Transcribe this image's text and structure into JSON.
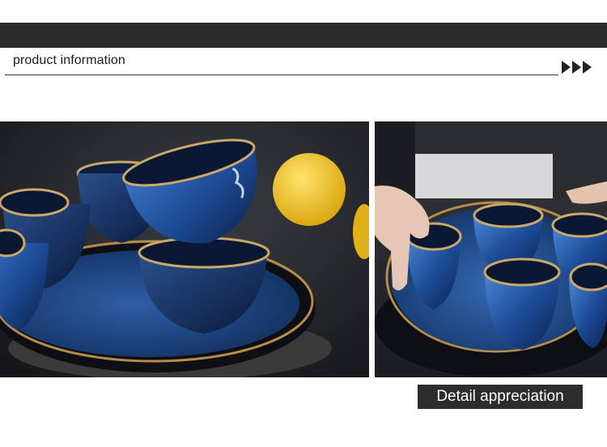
{
  "header": {
    "section_title": "product information"
  },
  "photos": [
    {
      "icon": "blue-ceramic-cups-on-tray-photo"
    },
    {
      "icon": "hands-arranging-blue-cups-photo"
    }
  ],
  "footer": {
    "detail_label": "Detail appreciation"
  },
  "colors": {
    "top_bar": "#2b2b2b",
    "glaze_blue": "#1f4f9a",
    "gold_rim": "#c9a86a",
    "lemon": "#f2c21b"
  }
}
